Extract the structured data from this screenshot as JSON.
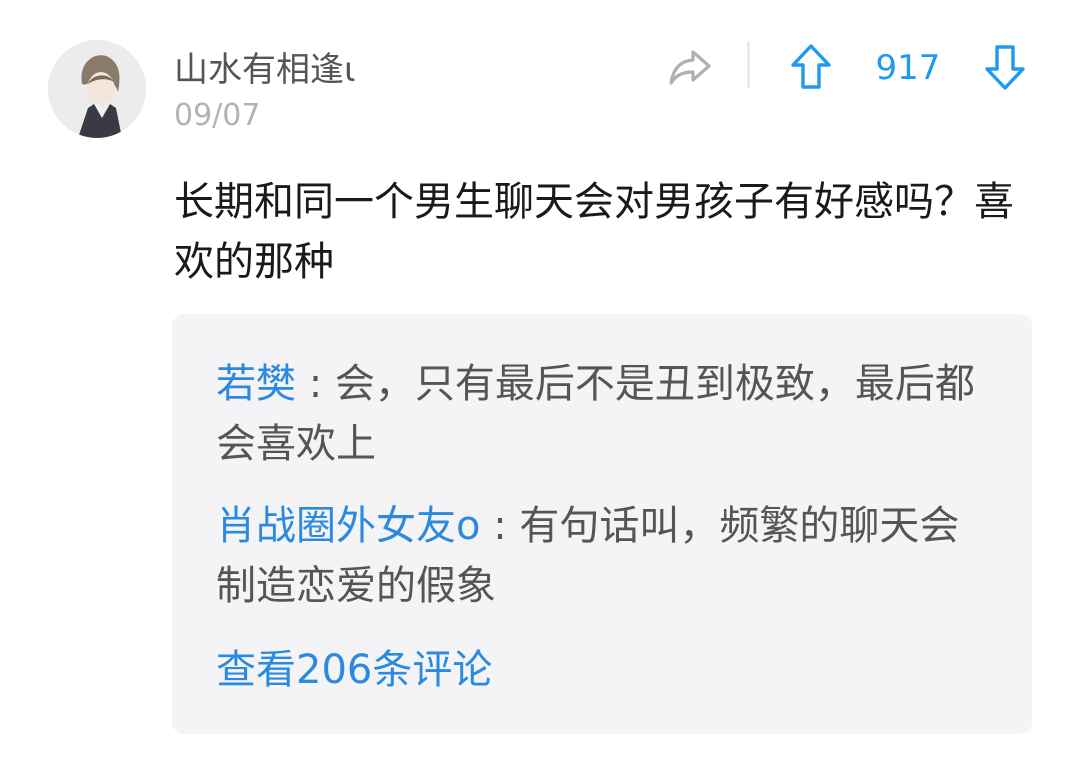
{
  "post": {
    "author": "山水有相逢ι",
    "date": "09/07",
    "content": "长期和同一个男生聊天会对男孩子有好感吗？喜欢的那种",
    "votes": "917"
  },
  "comments": [
    {
      "author": "若樊",
      "separator": " : ",
      "text": "会，只有最后不是丑到极致，最后都会喜欢上"
    },
    {
      "author": "肖战圈外女友o",
      "separator": " : ",
      "text": "有句话叫，频繁的聊天会制造恋爱的假象"
    }
  ],
  "view_all_label": "查看206条评论",
  "icons": {
    "share": "share-icon",
    "upvote": "arrow-up-icon",
    "downvote": "arrow-down-icon",
    "avatar": "user-avatar"
  },
  "colors": {
    "accent": "#1e9af0",
    "link": "#2b8ae0",
    "icon_gray": "#b0b0b0",
    "panel_bg": "#f4f4f6"
  }
}
